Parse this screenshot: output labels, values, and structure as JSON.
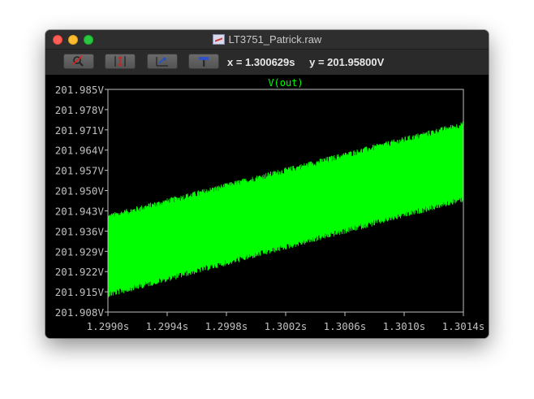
{
  "window": {
    "title": "LT3751_Patrick.raw",
    "colors": {
      "trace": "#00ff00",
      "background": "#000000",
      "axis": "#c0c0c0",
      "grid_text": "#c0c0c0"
    }
  },
  "toolbar": {
    "buttons": [
      {
        "name": "zoom-button",
        "icon": "magnifier-icon"
      },
      {
        "name": "autorange-y-button",
        "icon": "autorange-icon"
      },
      {
        "name": "zoom-back-button",
        "icon": "zoom-back-icon"
      },
      {
        "name": "probe-button",
        "icon": "hammer-probe-icon"
      }
    ],
    "cursor_x": "x = 1.300629s",
    "cursor_y": "y = 201.95800V"
  },
  "chart_data": {
    "type": "line",
    "trace_label": "V(out)",
    "xlim": [
      1.299,
      1.3014
    ],
    "ylim": [
      201.908,
      201.985
    ],
    "x_ticks": [
      1.299,
      1.2994,
      1.2998,
      1.3002,
      1.3006,
      1.301,
      1.3014
    ],
    "x_tick_labels": [
      "1.2990s",
      "1.2994s",
      "1.2998s",
      "1.3002s",
      "1.3006s",
      "1.3010s",
      "1.3014s"
    ],
    "y_ticks": [
      201.985,
      201.978,
      201.971,
      201.964,
      201.957,
      201.95,
      201.943,
      201.936,
      201.929,
      201.922,
      201.915,
      201.908
    ],
    "y_tick_labels": [
      "201.985V",
      "201.978V",
      "201.971V",
      "201.964V",
      "201.957V",
      "201.950V",
      "201.943V",
      "201.936V",
      "201.929V",
      "201.922V",
      "201.915V",
      "201.908V"
    ],
    "series": [
      {
        "x": [
          1.299,
          1.3014
        ],
        "upper": [
          201.94,
          201.972
        ],
        "lower": [
          201.915,
          201.948
        ]
      }
    ],
    "grid": false
  }
}
